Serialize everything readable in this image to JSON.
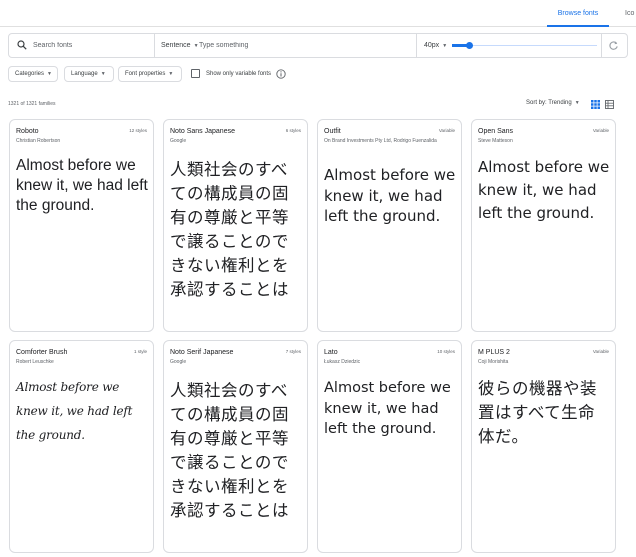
{
  "nav": {
    "browse_fonts": "Browse fonts",
    "icons": "Ico"
  },
  "search": {
    "placeholder": "Search fonts"
  },
  "preview": {
    "mode": "Sentence",
    "placeholder": "Type something",
    "size": "40px",
    "size_level_percent": 12
  },
  "filters": {
    "categories": "Categories",
    "language": "Language",
    "font_properties": "Font properties",
    "variable_only": "Show only variable fonts",
    "variable_only_checked": false
  },
  "results": {
    "count": "1321 of 1321 families",
    "sort": "Sort by: Trending",
    "view": "grid"
  },
  "cards": [
    {
      "name": "Roboto",
      "meta": "12 styles",
      "author": "Christian Robertson",
      "sample": "Almost before we knew it, we had left the ground.",
      "style": "roboto"
    },
    {
      "name": "Noto Sans Japanese",
      "meta": "6 styles",
      "author": "Google",
      "sample": "人類社会のすべての構成員の固有の尊厳と平等で譲ることのできない権利とを承認することは",
      "style": "jp"
    },
    {
      "name": "Outfit",
      "meta": "Variable",
      "author": "On Brand Investments Pty Ltd, Rodrigo Fuenzalida",
      "sample": "Almost before we knew it, we had left the ground.",
      "style": "latin"
    },
    {
      "name": "Open Sans",
      "meta": "Variable",
      "author": "Steve Matteson",
      "sample": "Almost before we knew it, we had left the ground.",
      "style": "latin"
    },
    {
      "name": "Comforter Brush",
      "meta": "1 style",
      "author": "Robert Leuschke",
      "sample": "Almost before we knew it, we had left the ground.",
      "style": "script"
    },
    {
      "name": "Noto Serif Japanese",
      "meta": "7 styles",
      "author": "Google",
      "sample": "人類社会のすべての構成員の固有の尊厳と平等で譲ることのできない権利とを承認することは",
      "style": "jp"
    },
    {
      "name": "Lato",
      "meta": "10 styles",
      "author": "Łukasz Dziedzic",
      "sample": "Almost before we knew it, we had left the ground.",
      "style": "latin"
    },
    {
      "name": "M PLUS 2",
      "meta": "Variable",
      "author": "Coji Morishita",
      "sample": "彼らの機器や装置はすべて生命体だ。",
      "style": "jp"
    }
  ]
}
